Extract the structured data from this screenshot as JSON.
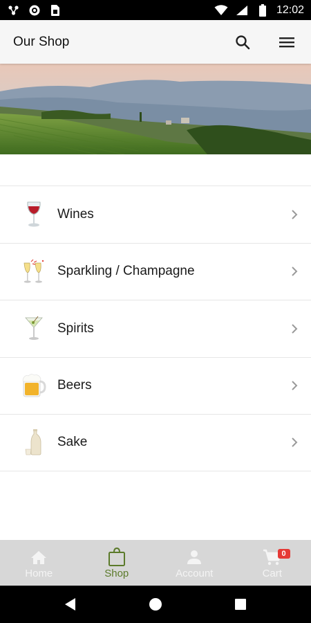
{
  "status_bar": {
    "time": "12:02",
    "icons": [
      "network-share-icon",
      "radio-icon",
      "sim-card-icon",
      "wifi-icon",
      "signal-icon",
      "battery-icon"
    ]
  },
  "app_bar": {
    "title": "Our Shop",
    "actions": [
      "search-icon",
      "menu-icon"
    ]
  },
  "banner": {
    "image": "vineyard-landscape",
    "sky_color": "#e8d0c4",
    "mountain_color": "#8fa0b4",
    "field_color": "#5e8a2c"
  },
  "categories": [
    {
      "label": "Wines",
      "icon": "wine-glass-icon"
    },
    {
      "label": "Sparkling / Champagne",
      "icon": "champagne-glasses-icon"
    },
    {
      "label": "Spirits",
      "icon": "cocktail-glass-icon"
    },
    {
      "label": "Beers",
      "icon": "beer-mug-icon"
    },
    {
      "label": "Sake",
      "icon": "sake-bottle-icon"
    }
  ],
  "bottom_nav": {
    "items": [
      {
        "label": "Home",
        "icon": "home-icon",
        "active": false
      },
      {
        "label": "Shop",
        "icon": "shopping-bag-icon",
        "active": true
      },
      {
        "label": "Account",
        "icon": "person-icon",
        "active": false
      },
      {
        "label": "Cart",
        "icon": "cart-icon",
        "active": false
      }
    ],
    "cart_count": "0",
    "active_color": "#5b7a2a",
    "badge_color": "#e53935"
  },
  "system_nav": [
    "back-icon",
    "home-circle-icon",
    "recents-icon"
  ]
}
